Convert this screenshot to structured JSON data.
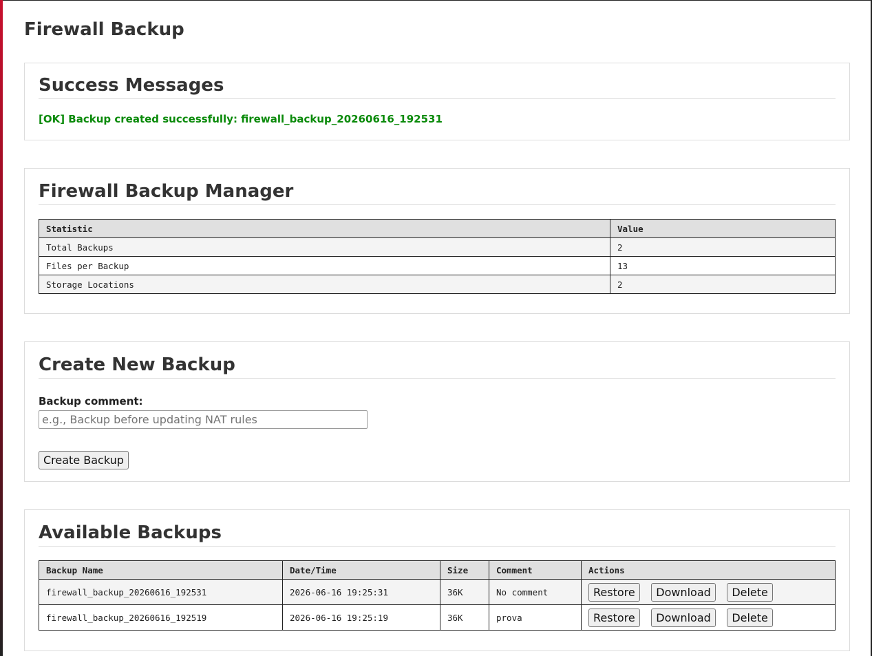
{
  "page": {
    "title": "Firewall Backup"
  },
  "success": {
    "title": "Success Messages",
    "message": "[OK] Backup created successfully: firewall_backup_20260616_192531",
    "color": "#0a8a0a"
  },
  "manager": {
    "title": "Firewall Backup Manager",
    "headers": {
      "statistic": "Statistic",
      "value": "Value"
    },
    "rows": [
      {
        "statistic": "Total Backups",
        "value": "2"
      },
      {
        "statistic": "Files per Backup",
        "value": "13"
      },
      {
        "statistic": "Storage Locations",
        "value": "2"
      }
    ]
  },
  "create": {
    "title": "Create New Backup",
    "label": "Backup comment:",
    "placeholder": "e.g., Backup before updating NAT rules",
    "button": "Create Backup"
  },
  "backups": {
    "title": "Available Backups",
    "headers": {
      "name": "Backup Name",
      "datetime": "Date/Time",
      "size": "Size",
      "comment": "Comment",
      "actions": "Actions"
    },
    "actions": {
      "restore": "Restore",
      "download": "Download",
      "delete": "Delete"
    },
    "rows": [
      {
        "name": "firewall_backup_20260616_192531",
        "datetime": "2026-06-16 19:25:31",
        "size": "36K",
        "comment": "No comment"
      },
      {
        "name": "firewall_backup_20260616_192519",
        "datetime": "2026-06-16 19:25:19",
        "size": "36K",
        "comment": "prova"
      }
    ]
  },
  "colors": {
    "accent": "#c8102e",
    "header_bg": "#e0e0e0",
    "border": "#222222"
  }
}
